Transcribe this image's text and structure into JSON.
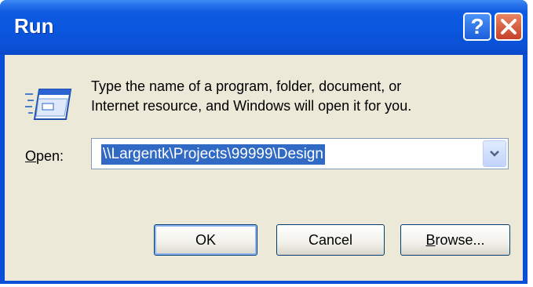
{
  "window": {
    "title": "Run",
    "help_label": "?",
    "colors": {
      "titlebar": "#0A56DE",
      "client": "#ECE9D8",
      "close": "#D35A3C",
      "selection": "#316AC5"
    }
  },
  "icons": {
    "run": "run-program-icon",
    "help": "question-mark-icon",
    "close": "close-x-icon",
    "dropdown": "chevron-down-icon"
  },
  "description": {
    "line1": "Type the name of a program, folder, document, or",
    "line2": "Internet resource, and Windows will open it for you."
  },
  "open": {
    "label_first": "O",
    "label_rest": "pen:",
    "value": "\\\\Largentk\\Projects\\99999\\Design"
  },
  "buttons": {
    "ok": "OK",
    "cancel": "Cancel",
    "browse_first": "B",
    "browse_rest": "rowse..."
  }
}
